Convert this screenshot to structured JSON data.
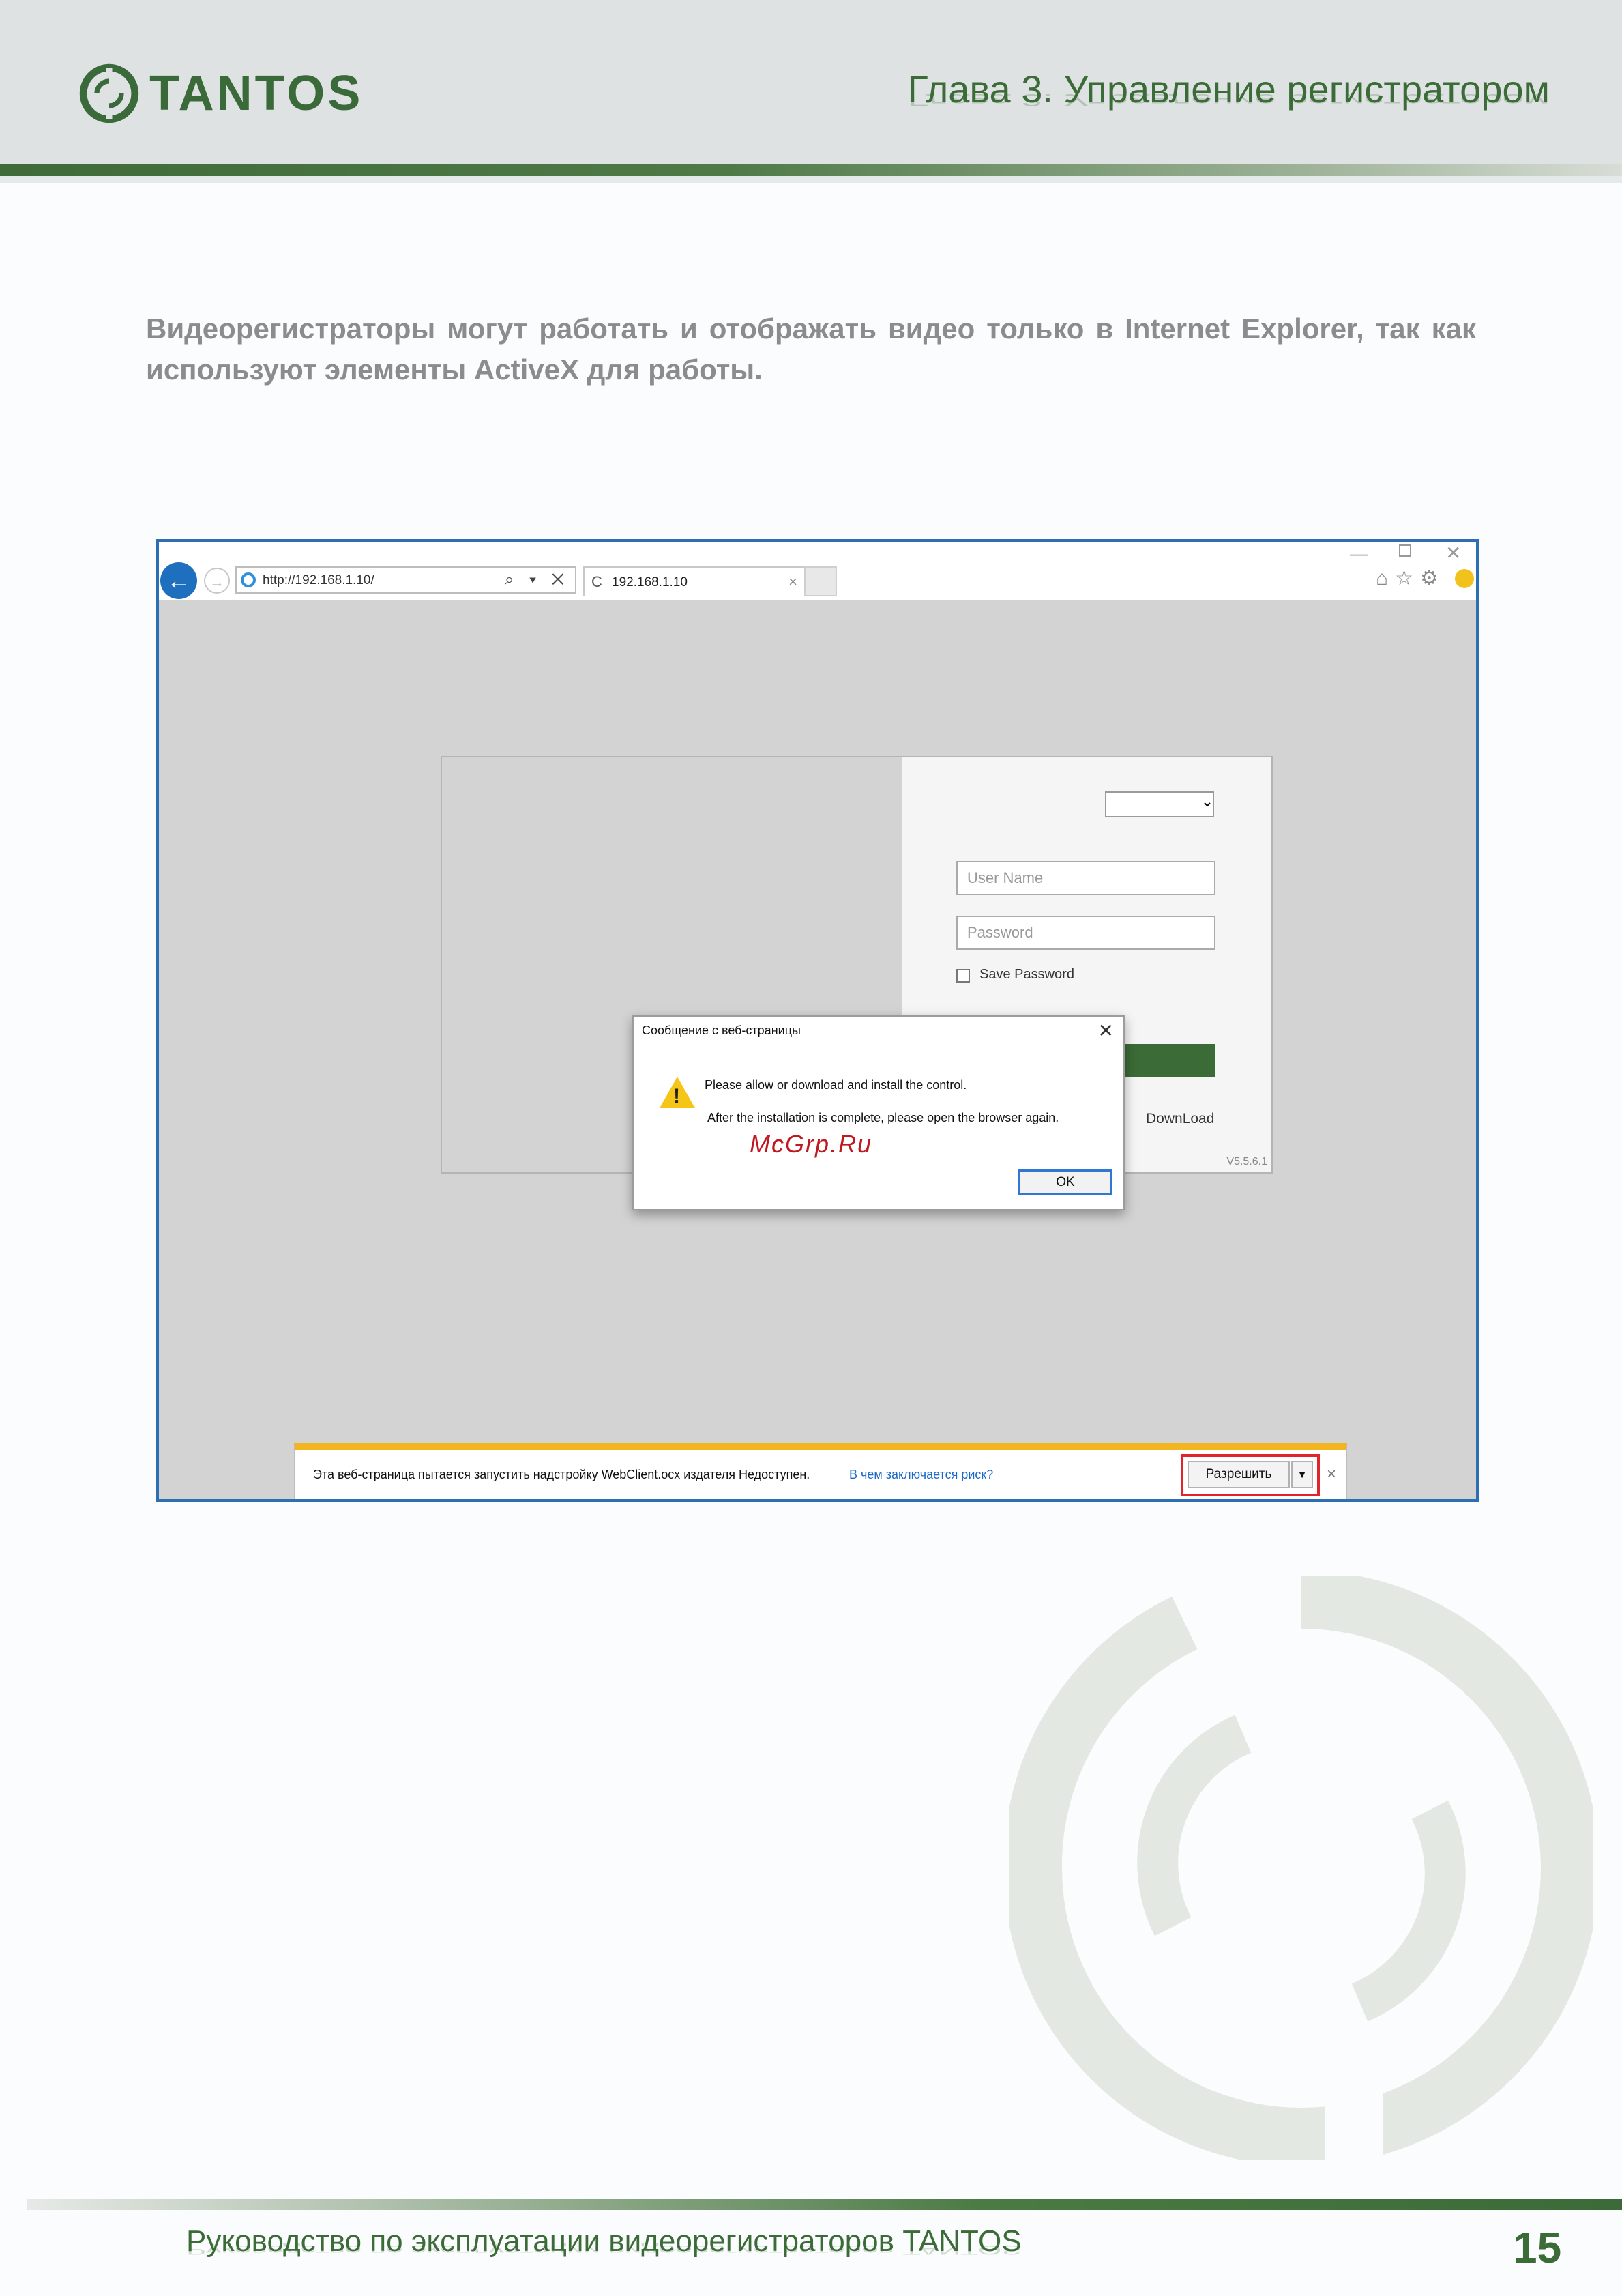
{
  "header": {
    "logo_text": "TANTOS",
    "chapter_title": "Глава 3. Управление регистратором"
  },
  "intro_text": "Видеорегистраторы могут работать и отображать видео только в Internet Explorer, так как используют элементы ActiveX для работы.",
  "browser": {
    "address": "http://192.168.1.10/",
    "address_tools": "⌕ ▾ ✕",
    "tab_title": "192.168.1.10",
    "tab_refresh": "C",
    "tab_close": "×",
    "back_glyph": "←",
    "forward_glyph": "→",
    "win_min": "—",
    "win_close": "✕",
    "nav_icons": "⌂☆⚙"
  },
  "login": {
    "username_placeholder": "User Name",
    "password_placeholder": "Password",
    "save_password_label": "Save Password",
    "download_label": "DownLoad",
    "version": "V5.5.6.1"
  },
  "dialog": {
    "title": "Сообщение с веб-страницы",
    "close": "✕",
    "line1": "Please allow or download and install the control.",
    "line2": "After the installation is complete, please open the browser again.",
    "watermark": "McGrp.Ru",
    "ok_label": "OK",
    "warn_mark": "!"
  },
  "notification": {
    "text": "Эта веб-страница пытается запустить надстройку WebClient.ocx издателя Недоступен.",
    "link": "В чем заключается риск?",
    "allow_label": "Разрешить",
    "dropdown": "▼",
    "close": "×"
  },
  "footer": {
    "title": "Руководство по эксплуатации видеорегистраторов TANTOS",
    "page_number": "15"
  },
  "colors": {
    "brand_green": "#3b6b37",
    "ie_blue": "#2e6fb3",
    "alert_yellow": "#f2b51f",
    "highlight_red": "#e2252b"
  }
}
